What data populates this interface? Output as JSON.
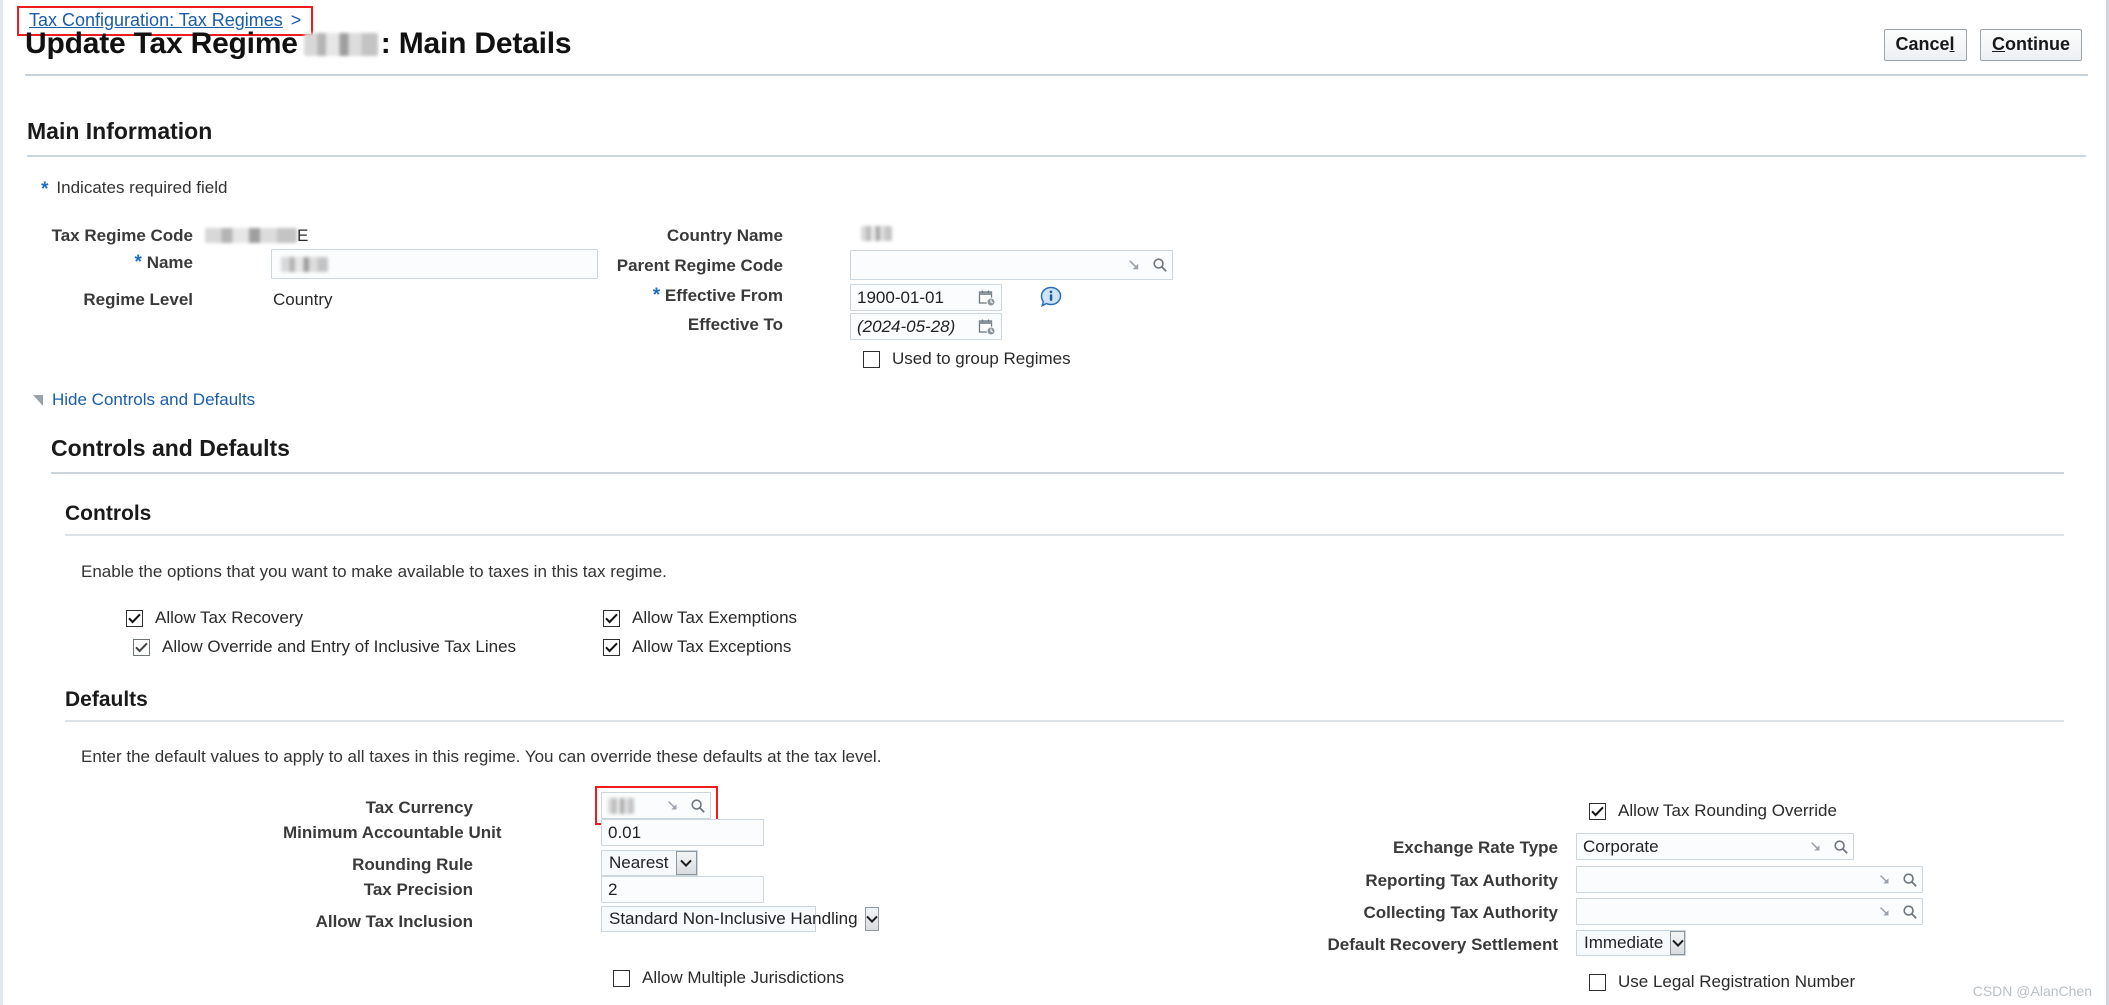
{
  "breadcrumb": {
    "link_label": "Tax Configuration: Tax Regimes",
    "separator": ">"
  },
  "header": {
    "title_prefix": "Update Tax Regime",
    "title_suffix": ": Main Details",
    "redacted_name": "",
    "buttons": {
      "cancel": {
        "before": "Cance",
        "accesskey": "l",
        "after": ""
      },
      "continue": {
        "before": "",
        "accesskey": "C",
        "after": "ontinue"
      }
    }
  },
  "main_information": {
    "heading": "Main Information",
    "required_note": "Indicates required field",
    "required_marker": "*",
    "left_fields": {
      "tax_regime_code": {
        "label": "Tax Regime Code",
        "value_visible_tail": "E",
        "redacted": true
      },
      "name": {
        "label": "Name",
        "required": true,
        "value": "",
        "redacted": true
      },
      "regime_level": {
        "label": "Regime Level",
        "value": "Country"
      }
    },
    "right_fields": {
      "country_name": {
        "label": "Country Name",
        "value": "",
        "redacted": true
      },
      "parent_regime_code": {
        "label": "Parent Regime Code",
        "value": "",
        "placeholder": ""
      },
      "effective_from": {
        "label": "Effective From",
        "required": true,
        "value": "1900-01-01"
      },
      "effective_to": {
        "label": "Effective To",
        "value": "(2024-05-28)"
      },
      "used_to_group_regimes": {
        "label": "Used to group Regimes",
        "checked": false
      }
    }
  },
  "disclosure": {
    "label": "Hide Controls and Defaults",
    "expanded": true
  },
  "controls_and_defaults": {
    "heading": "Controls and Defaults",
    "controls": {
      "heading": "Controls",
      "description": "Enable the options that you want to make available to taxes in this tax regime.",
      "checkboxes": [
        {
          "label": "Allow Tax Recovery",
          "checked": true,
          "column": "left"
        },
        {
          "label": "Allow Override and Entry of Inclusive Tax Lines",
          "checked": true,
          "column": "left",
          "dimmed": true
        },
        {
          "label": "Allow Tax Exemptions",
          "checked": true,
          "column": "right"
        },
        {
          "label": "Allow Tax Exceptions",
          "checked": true,
          "column": "right"
        }
      ]
    },
    "defaults": {
      "heading": "Defaults",
      "description": "Enter the default values to apply to all taxes in this regime. You can override these defaults at the tax level.",
      "left_fields": {
        "tax_currency": {
          "label": "Tax Currency",
          "value": "",
          "redacted": true,
          "highlighted": true
        },
        "minimum_accountable_unit": {
          "label": "Minimum Accountable Unit",
          "value": "0.01"
        },
        "rounding_rule": {
          "label": "Rounding Rule",
          "value": "Nearest"
        },
        "tax_precision": {
          "label": "Tax Precision",
          "value": "2"
        },
        "allow_tax_inclusion": {
          "label": "Allow Tax Inclusion",
          "value": "Standard Non-Inclusive Handling"
        },
        "allow_multiple_jurisdictions": {
          "label": "Allow Multiple Jurisdictions",
          "checked": false
        }
      },
      "right_fields": {
        "allow_tax_rounding_override": {
          "label": "Allow Tax Rounding Override",
          "checked": true
        },
        "exchange_rate_type": {
          "label": "Exchange Rate Type",
          "value": "Corporate"
        },
        "reporting_tax_authority": {
          "label": "Reporting Tax Authority",
          "value": ""
        },
        "collecting_tax_authority": {
          "label": "Collecting Tax Authority",
          "value": ""
        },
        "default_recovery_settlement": {
          "label": "Default Recovery Settlement",
          "value": "Immediate"
        },
        "use_legal_registration_number": {
          "label": "Use Legal Registration Number",
          "checked": false
        }
      }
    }
  },
  "watermark": "CSDN @AlanChen",
  "colors": {
    "link": "#1b5dab",
    "highlight": "#ee1c1c",
    "required_star": "#1d6ec9",
    "rule": "#ccd6de"
  }
}
